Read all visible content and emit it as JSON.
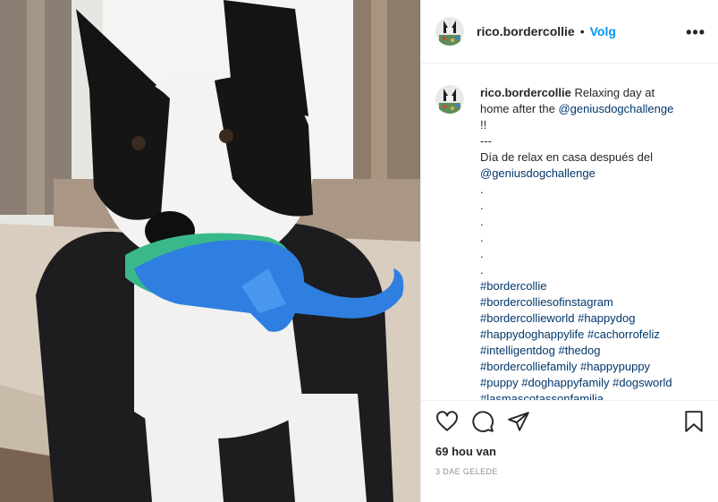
{
  "post": {
    "username": "rico.bordercollie",
    "dot": "•",
    "follow_label": "Volg",
    "more_label": "•••"
  },
  "caption": {
    "username": "rico.bordercollie",
    "lines": [
      {
        "text": "Relaxing day at",
        "type": "text",
        "prefix_user": true
      },
      {
        "text": "home after the ",
        "type": "text"
      },
      {
        "text": "!!",
        "type": "text"
      },
      {
        "text": "---",
        "type": "text"
      },
      {
        "text": "Día de relax en casa después del",
        "type": "text"
      },
      {
        "text": "@geniusdogchallenge",
        "type": "link"
      },
      {
        "text": ".",
        "type": "text"
      },
      {
        "text": ".",
        "type": "text"
      },
      {
        "text": ".",
        "type": "text"
      },
      {
        "text": ".",
        "type": "text"
      },
      {
        "text": ".",
        "type": "text"
      },
      {
        "text": ".",
        "type": "text"
      },
      {
        "text": "#bordercollie",
        "type": "link"
      },
      {
        "text": "#bordercolliesofinstagram",
        "type": "link"
      },
      {
        "text": "#bordercollieworld #happydog",
        "type": "link"
      },
      {
        "text": "#happydoghappylife #cachorrofeliz",
        "type": "link"
      },
      {
        "text": "#intelligentdog #thedog",
        "type": "link"
      },
      {
        "text": "#bordercolliefamily #happypuppy",
        "type": "link"
      },
      {
        "text": "#puppy #doghappyfamily #dogsworld",
        "type": "link"
      },
      {
        "text": "#lasmascotassonfamilia",
        "type": "link"
      }
    ],
    "mention_1": "@geniusdogchallenge"
  },
  "actions": {
    "like_icon": "heart-icon",
    "comment_icon": "comment-icon",
    "share_icon": "share-icon",
    "save_icon": "bookmark-icon"
  },
  "likes": "69 hou van",
  "timestamp": "3 DAE GELEDE",
  "colors": {
    "link": "#00376b",
    "follow": "#0095f6",
    "toy_blue": "#2f7fe0",
    "toy_green": "#39b98a"
  }
}
